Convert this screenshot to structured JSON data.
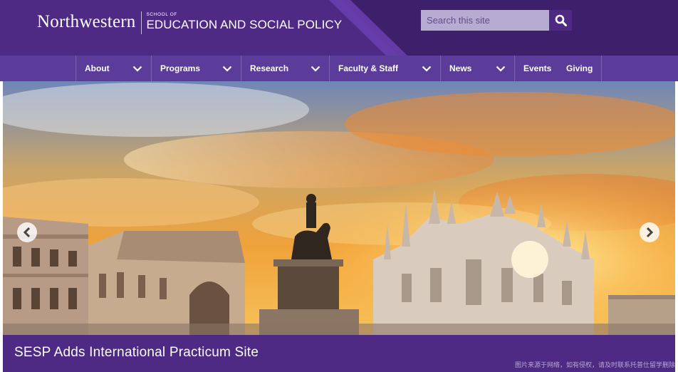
{
  "header": {
    "logo_wordmark": "Northwestern",
    "school_small": "SCHOOL OF",
    "school_name": "EDUCATION AND SOCIAL POLICY",
    "search_placeholder": "Search this site",
    "search_icon": "search-icon",
    "colors": {
      "purple": "#4e2a84",
      "dark_purple": "#3d1f6c",
      "nav": "#5b3c9a"
    }
  },
  "nav": {
    "items": [
      {
        "label": "About",
        "has_dropdown": true
      },
      {
        "label": "Programs",
        "has_dropdown": true
      },
      {
        "label": "Research",
        "has_dropdown": true
      },
      {
        "label": "Faculty & Staff",
        "has_dropdown": true
      },
      {
        "label": "News",
        "has_dropdown": true
      },
      {
        "label": "Events",
        "has_dropdown": false
      },
      {
        "label": "Giving",
        "has_dropdown": false
      }
    ]
  },
  "hero": {
    "caption": "SESP Adds International Practicum Site",
    "prev_icon": "chevron-left-icon",
    "next_icon": "chevron-right-icon",
    "watermark": "图片来源于网络，如有侵权，请及时联系托普仕留学删除"
  }
}
